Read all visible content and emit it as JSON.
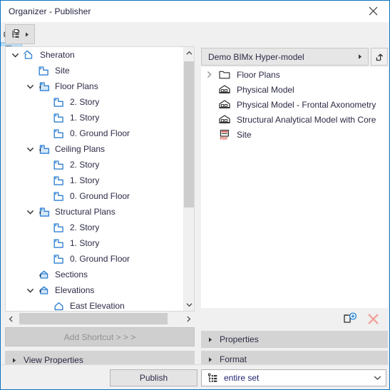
{
  "window": {
    "title": "Organizer - Publisher",
    "close_icon": "close-icon",
    "border_color": "#0a73c2"
  },
  "toolbar": {
    "tree_button": {
      "icon": "hierarchy-tree-icon",
      "dropdown_icon": "caret-right-icon"
    },
    "left_view_modes": [
      {
        "name": "model-view-icon",
        "selected": false
      },
      {
        "name": "floor-plan-icon",
        "selected": true
      },
      {
        "name": "section-view-icon",
        "selected": false
      },
      {
        "name": "layout-sheets-icon",
        "selected": false
      }
    ],
    "right_view_modes": [
      {
        "name": "floor-plan-icon",
        "selected": false
      },
      {
        "name": "section-view-icon",
        "selected": false
      },
      {
        "name": "layout-sheets-icon",
        "selected": true
      }
    ],
    "selected_color": "#b8dcf7"
  },
  "left_panel": {
    "tree": [
      {
        "label": "Sheraton",
        "indent": 0,
        "twist": "down",
        "icon": "project-house-icon"
      },
      {
        "label": "Site",
        "indent": 1,
        "twist": "none",
        "icon": "floor-plan-icon"
      },
      {
        "label": "Floor Plans",
        "indent": 1,
        "twist": "down",
        "icon": "floor-plan-folder-icon"
      },
      {
        "label": "2. Story",
        "indent": 2,
        "twist": "none",
        "icon": "floor-plan-icon"
      },
      {
        "label": "1. Story",
        "indent": 2,
        "twist": "none",
        "icon": "floor-plan-icon"
      },
      {
        "label": "0. Ground Floor",
        "indent": 2,
        "twist": "none",
        "icon": "floor-plan-icon"
      },
      {
        "label": "Ceiling Plans",
        "indent": 1,
        "twist": "down",
        "icon": "floor-plan-folder-icon"
      },
      {
        "label": "2. Story",
        "indent": 2,
        "twist": "none",
        "icon": "floor-plan-icon"
      },
      {
        "label": "1. Story",
        "indent": 2,
        "twist": "none",
        "icon": "floor-plan-icon"
      },
      {
        "label": "0. Ground Floor",
        "indent": 2,
        "twist": "none",
        "icon": "floor-plan-icon"
      },
      {
        "label": "Structural Plans",
        "indent": 1,
        "twist": "down",
        "icon": "floor-plan-folder-icon"
      },
      {
        "label": "2. Story",
        "indent": 2,
        "twist": "none",
        "icon": "floor-plan-icon"
      },
      {
        "label": "1. Story",
        "indent": 2,
        "twist": "none",
        "icon": "floor-plan-icon"
      },
      {
        "label": "0. Ground Floor",
        "indent": 2,
        "twist": "none",
        "icon": "floor-plan-icon"
      },
      {
        "label": "Sections",
        "indent": 1,
        "twist": "none",
        "icon": "section-folder-icon"
      },
      {
        "label": "Elevations",
        "indent": 1,
        "twist": "down",
        "icon": "section-folder-icon"
      },
      {
        "label": "East Elevation",
        "indent": 2,
        "twist": "none",
        "icon": "elevation-icon"
      }
    ],
    "add_shortcut_label": "Add Shortcut > > >",
    "view_properties_label": "View Properties"
  },
  "right_panel": {
    "path_value": "Demo BIMx Hyper-model",
    "path_dropdown_icon": "caret-right-icon",
    "nav_up_icon": "arrow-up-level-icon",
    "items": [
      {
        "label": "Floor Plans",
        "twist": "right",
        "icon": "folder-icon"
      },
      {
        "label": "Physical Model",
        "twist": "none",
        "icon": "bimx-model-icon"
      },
      {
        "label": "Physical Model - Frontal Axonometry",
        "twist": "none",
        "icon": "bimx-model-icon"
      },
      {
        "label": "Structural Analytical Model with Core",
        "twist": "none",
        "icon": "bimx-model-icon"
      },
      {
        "label": "Site",
        "twist": "none",
        "icon": "pdf-icon"
      }
    ],
    "actions": [
      {
        "name": "new-folder-icon",
        "accent": "#1b7fd4"
      },
      {
        "name": "delete-icon",
        "accent": "#f2a39b"
      }
    ],
    "properties_label": "Properties",
    "format_label": "Format"
  },
  "bottom_bar": {
    "publish_label": "Publish",
    "set_selector": {
      "icon": "set-list-icon",
      "value": "entire set",
      "arrow_icon": "chevron-down-icon"
    }
  }
}
